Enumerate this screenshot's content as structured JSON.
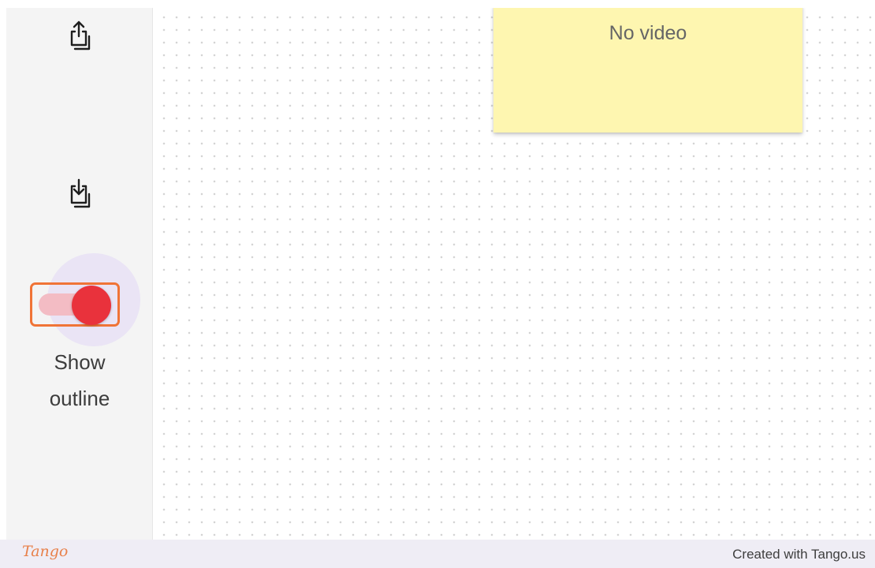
{
  "sidebar": {
    "export_icon": "share-upload-icon",
    "import_icon": "download-import-icon",
    "toggle": {
      "label_line1": "Show",
      "label_line2": "outline",
      "state": "on"
    }
  },
  "canvas": {
    "sticky_note": {
      "text": "No video",
      "color": "#fef6b0"
    }
  },
  "footer": {
    "brand": "Tango",
    "credit": "Created with Tango.us"
  },
  "colors": {
    "highlight": "#f07437",
    "toggle_thumb": "#e9323c",
    "toggle_track": "#f3bcc4"
  }
}
